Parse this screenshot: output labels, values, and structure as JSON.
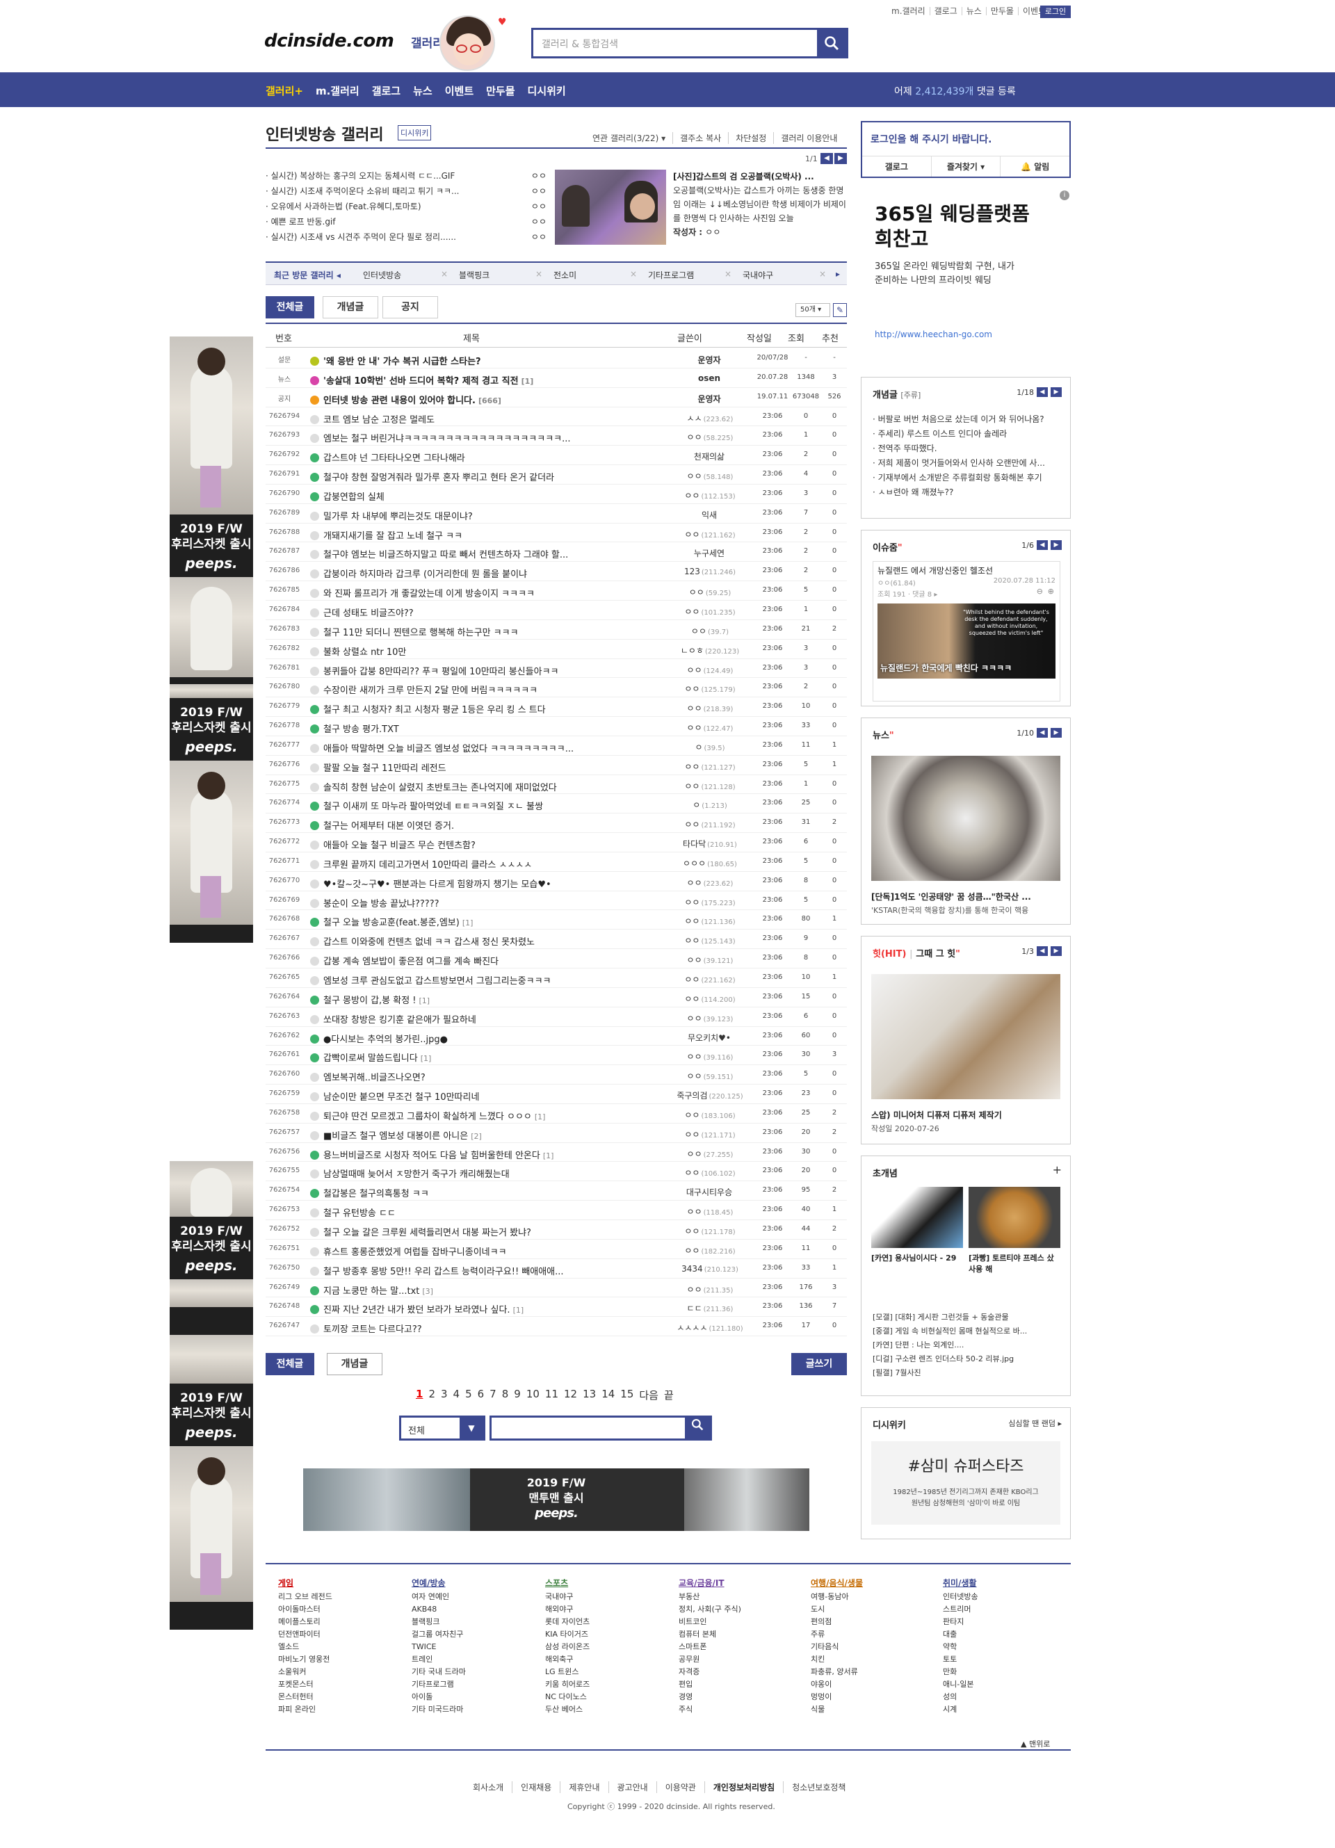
{
  "util_links": [
    "m.갤러리",
    "갤로그",
    "뉴스",
    "만두몰",
    "이벤트"
  ],
  "login_label": "로그인",
  "logo": {
    "main": "dcinside.com",
    "sub": "갤러리"
  },
  "search": {
    "placeholder": "갤러리 & 통합검색"
  },
  "nav": {
    "items": [
      "갤러리+",
      "m.갤러리",
      "갤로그",
      "뉴스",
      "이벤트",
      "만두몰",
      "디시위키"
    ],
    "stat_prefix": "어제",
    "stat_count": "2,412,439개",
    "stat_suffix": "댓글 등록"
  },
  "gallery": {
    "title": "인터넷방송 갤러리",
    "wiki_badge": "디시위키",
    "tools": [
      "연관 갤러리(3/22) ▾",
      "갤주소 복사",
      "차단설정",
      "갤러리 이용안내"
    ]
  },
  "issue": {
    "page": "1/1",
    "list": [
      {
        "t": "· 실시간) 복상하는 홍구의 오지는 동체시력 ㄷㄷ...GIF",
        "w": "ㅇㅇ"
      },
      {
        "t": "· 실시간) 시조새 주먹이운다 소유비 때리고 튀기 ㅋㅋ...",
        "w": "ㅇㅇ"
      },
      {
        "t": "· 오유에서 사과하는법 (Feat.유혜디,토마토)",
        "w": "ㅇㅇ"
      },
      {
        "t": "· 예쁜 로프 반동.gif",
        "w": "ㅇㅇ"
      },
      {
        "t": "· 실시간) 시조새 vs 시견주 주먹이 운다 필로 정리......",
        "w": "ㅇㅇ"
      }
    ],
    "feature_title": "[사진]갑스트의 검 오공블랙(오박사) ...",
    "feature_body": "오공블랙(오박사)는 갑스트가 아끼는 동생중 한명임 이래는 ↓↓베소영님이란 학생 비제이가 비제이를 한명씩 다 인사하는 사진임 오늘",
    "feature_writer_label": "작성자 : ",
    "feature_writer": "ㅇㅇ"
  },
  "recent": {
    "label": "최근 방문 갤러리",
    "items": [
      "인터넷방송",
      "블랙핑크",
      "전소미",
      "기타프로그램",
      "국내야구"
    ]
  },
  "tabs": [
    "전체글",
    "개념글",
    "공지"
  ],
  "per_page": "50개",
  "columns": [
    "번호",
    "제목",
    "글쓴이",
    "작성일",
    "조회",
    "추천"
  ],
  "posts": [
    {
      "no": "설문",
      "icon": "y",
      "title": "'왜 응반 안 내' 가수 복귀 시급한 스타는?",
      "rc": "",
      "writer": "운영자",
      "ip": "",
      "date": "20/07/28",
      "view": "-",
      "rec": "-",
      "notice": true
    },
    {
      "no": "뉴스",
      "icon": "m",
      "title": "'송살대 10학번' 선바 드디어 복학? 제적 경고 직전",
      "rc": "[1]",
      "writer": "osen",
      "ip": "",
      "date": "20.07.28",
      "view": "1348",
      "rec": "3",
      "notice": true
    },
    {
      "no": "공지",
      "icon": "o",
      "title": "인터넷 방송 관련 내용이 있어야 합니다.",
      "rc": "[666]",
      "writer": "운영자",
      "ip": "",
      "date": "19.07.11",
      "view": "673048",
      "rec": "526",
      "notice": true
    },
    {
      "no": "7626794",
      "icon": "",
      "title": "코트 엠보 남순 고정은 멀레도",
      "rc": "",
      "writer": "ㅅㅅ",
      "ip": "(223.62)",
      "date": "23:06",
      "view": "0",
      "rec": "0"
    },
    {
      "no": "7626793",
      "icon": "",
      "title": "엠보는 철구 버린거냐ㅋㅋㅋㅋㅋㅋㅋㅋㅋㅋㅋㅋㅋㅋㅋㅋㅋㅋㅋ...",
      "rc": "",
      "writer": "ㅇㅇ",
      "ip": "(58.225)",
      "date": "23:06",
      "view": "1",
      "rec": "0"
    },
    {
      "no": "7626792",
      "icon": "g",
      "title": "갑스트야 넌 그타타나오면 그타나해라",
      "rc": "",
      "writer": "천재의삶",
      "ip": "",
      "date": "23:06",
      "view": "2",
      "rec": "0"
    },
    {
      "no": "7626791",
      "icon": "g",
      "title": "철구야 창현 잘멍겨줘라 밀가루 혼자 뿌리고 현타 온거 같더라",
      "rc": "",
      "writer": "ㅇㅇ",
      "ip": "(58.148)",
      "date": "23:06",
      "view": "4",
      "rec": "0"
    },
    {
      "no": "7626790",
      "icon": "g",
      "title": "갑붕연합의 실체",
      "rc": "",
      "writer": "ㅇㅇ",
      "ip": "(112.153)",
      "date": "23:06",
      "view": "3",
      "rec": "0"
    },
    {
      "no": "7626789",
      "icon": "",
      "title": "밀가루 차 내부에 뿌리는것도 대문이냐?",
      "rc": "",
      "writer": "익새",
      "ip": "",
      "date": "23:06",
      "view": "7",
      "rec": "0"
    },
    {
      "no": "7626788",
      "icon": "",
      "title": "개돼지새기를 잘 잡고 노네 철구 ㅋㅋ",
      "rc": "",
      "writer": "ㅇㅇ",
      "ip": "(121.162)",
      "date": "23:06",
      "view": "2",
      "rec": "0"
    },
    {
      "no": "7626787",
      "icon": "",
      "title": "철구야 엠보는 비글즈하지말고 따로 빼서 컨텐츠하자 그래야 할...",
      "rc": "",
      "writer": "누구세연",
      "ip": "",
      "date": "23:06",
      "view": "2",
      "rec": "0"
    },
    {
      "no": "7626786",
      "icon": "",
      "title": "갑붕이라 하지마라 갑크루 (이거리한데 뭔 롤을 붙이냐",
      "rc": "",
      "writer": "123",
      "ip": "(211.246)",
      "date": "23:06",
      "view": "2",
      "rec": "0"
    },
    {
      "no": "7626785",
      "icon": "",
      "title": "와 진짜 롤프리가 개 좋갈았는데 이게 방송이지 ㅋㅋㅋㅋ",
      "rc": "",
      "writer": "ㅇㅇ",
      "ip": "(59.25)",
      "date": "23:06",
      "view": "5",
      "rec": "0"
    },
    {
      "no": "7626784",
      "icon": "",
      "title": "근데 성태도 비글즈야??",
      "rc": "",
      "writer": "ㅇㅇ",
      "ip": "(101.235)",
      "date": "23:06",
      "view": "1",
      "rec": "0"
    },
    {
      "no": "7626783",
      "icon": "",
      "title": "철구 11만 되더니 찐텐으로 행복해 하는구만 ㅋㅋㅋ",
      "rc": "",
      "writer": "ㅇㅇ",
      "ip": "(39.7)",
      "date": "23:06",
      "view": "21",
      "rec": "2"
    },
    {
      "no": "7626782",
      "icon": "",
      "title": "불화 상렬쇼 ntr 10만",
      "rc": "",
      "writer": "ㄴㅇㅎ",
      "ip": "(220.123)",
      "date": "23:06",
      "view": "3",
      "rec": "0"
    },
    {
      "no": "7626781",
      "icon": "",
      "title": "봉퀴들아 갑붕 8만따리?? 푸ㅋ 평일에 10만따리 봉신들아ㅋㅋ",
      "rc": "",
      "writer": "ㅇㅇ",
      "ip": "(124.49)",
      "date": "23:06",
      "view": "3",
      "rec": "0"
    },
    {
      "no": "7626780",
      "icon": "",
      "title": "수장이란 새끼가 크루 만든지 2달 만에 버림ㅋㅋㅋㅋㅋㅋ",
      "rc": "",
      "writer": "ㅇㅇ",
      "ip": "(125.179)",
      "date": "23:06",
      "view": "2",
      "rec": "0"
    },
    {
      "no": "7626779",
      "icon": "g",
      "title": "철구 최고 시청자? 최고 시청자 평균 1등은 우리 킹 스 트다",
      "rc": "",
      "writer": "ㅇㅇ",
      "ip": "(218.39)",
      "date": "23:06",
      "view": "10",
      "rec": "0"
    },
    {
      "no": "7626778",
      "icon": "g",
      "title": "철구 방송 평가.TXT",
      "rc": "",
      "writer": "ㅇㅇ",
      "ip": "(122.47)",
      "date": "23:06",
      "view": "33",
      "rec": "0"
    },
    {
      "no": "7626777",
      "icon": "",
      "title": "애들아 딱말하면 오늘 비글즈 엠보성 없었다 ㅋㅋㅋㅋㅋㅋㅋㅋㅋ...",
      "rc": "",
      "writer": "ㅇ",
      "ip": "(39.5)",
      "date": "23:06",
      "view": "11",
      "rec": "1"
    },
    {
      "no": "7626776",
      "icon": "",
      "title": "팔팔 오늘 철구 11만따리 레전드",
      "rc": "",
      "writer": "ㅇㅇ",
      "ip": "(121.127)",
      "date": "23:06",
      "view": "5",
      "rec": "1"
    },
    {
      "no": "7626775",
      "icon": "",
      "title": "솔직히 창현 남순이 살렸지 초반토크는 존나억지에 재미없었다",
      "rc": "",
      "writer": "ㅇㅇ",
      "ip": "(121.128)",
      "date": "23:06",
      "view": "1",
      "rec": "0"
    },
    {
      "no": "7626774",
      "icon": "g",
      "title": "철구 이새끼 또 마누라 팔아먹었네 ㅌㅌㅋㅋ외질 ㅈㄴ 불쌍",
      "rc": "",
      "writer": "ㅇ",
      "ip": "(1.213)",
      "date": "23:06",
      "view": "25",
      "rec": "0"
    },
    {
      "no": "7626773",
      "icon": "g",
      "title": "철구는 어제부터 대본 이엿던 증거.",
      "rc": "",
      "writer": "ㅇㅇ",
      "ip": "(211.192)",
      "date": "23:06",
      "view": "31",
      "rec": "2"
    },
    {
      "no": "7626772",
      "icon": "",
      "title": "애들아 오늘 철구 비글즈 무슨 컨텐츠함?",
      "rc": "",
      "writer": "타다닥",
      "ip": "(210.91)",
      "date": "23:06",
      "view": "6",
      "rec": "0"
    },
    {
      "no": "7626771",
      "icon": "",
      "title": "크루원 끝까지 데리고가면서 10만따리 클라스 ㅅㅅㅅㅅ",
      "rc": "",
      "writer": "ㅇㅇㅇ",
      "ip": "(180.65)",
      "date": "23:06",
      "view": "5",
      "rec": "0"
    },
    {
      "no": "7626770",
      "icon": "",
      "title": "♥•칼~갓~구♥• 팬분과는 다르게 힘왕까지 챙기는 모습♥•",
      "rc": "",
      "writer": "ㅇㅇ",
      "ip": "(223.62)",
      "date": "23:06",
      "view": "8",
      "rec": "0"
    },
    {
      "no": "7626769",
      "icon": "",
      "title": "봉순이 오늘 방송 끝났냐?????",
      "rc": "",
      "writer": "ㅇㅇ",
      "ip": "(175.223)",
      "date": "23:06",
      "view": "5",
      "rec": "0"
    },
    {
      "no": "7626768",
      "icon": "g",
      "title": "철구 오늘 방송교훈(feat.봉준,엠보)",
      "rc": "[1]",
      "writer": "ㅇㅇ",
      "ip": "(121.136)",
      "date": "23:06",
      "view": "80",
      "rec": "1"
    },
    {
      "no": "7626767",
      "icon": "",
      "title": "갑스트 이와중에 컨텐츠 없네 ㅋㅋ 갑스새 정신 못차렸노",
      "rc": "",
      "writer": "ㅇㅇ",
      "ip": "(125.143)",
      "date": "23:06",
      "view": "9",
      "rec": "0"
    },
    {
      "no": "7626766",
      "icon": "",
      "title": "갑봉 계속 엠보밥이 좋은점 여그를 계속 빠진다",
      "rc": "",
      "writer": "ㅇㅇ",
      "ip": "(39.121)",
      "date": "23:06",
      "view": "8",
      "rec": "0"
    },
    {
      "no": "7626765",
      "icon": "",
      "title": "엠보성 크루 관심도없고 갑스트방보면서 그림그리는중ㅋㅋㅋ",
      "rc": "",
      "writer": "ㅇㅇ",
      "ip": "(221.162)",
      "date": "23:06",
      "view": "10",
      "rec": "1"
    },
    {
      "no": "7626764",
      "icon": "g",
      "title": "철구 몽방이 갑,봉 확정 !",
      "rc": "[1]",
      "writer": "ㅇㅇ",
      "ip": "(114.200)",
      "date": "23:06",
      "view": "15",
      "rec": "0"
    },
    {
      "no": "7626763",
      "icon": "",
      "title": "쏘대장 창방은 킹기훈 같은애가 필요하네",
      "rc": "",
      "writer": "ㅇㅇ",
      "ip": "(39.123)",
      "date": "23:06",
      "view": "6",
      "rec": "0"
    },
    {
      "no": "7626762",
      "icon": "g",
      "title": "●다시보는 추억의 봉가린..jpg●",
      "rc": "",
      "writer": "무오키치♥•",
      "ip": "",
      "date": "23:06",
      "view": "60",
      "rec": "0"
    },
    {
      "no": "7626761",
      "icon": "g",
      "title": "갑빡이로써 말씀드립니다",
      "rc": "[1]",
      "writer": "ㅇㅇ",
      "ip": "(39.116)",
      "date": "23:06",
      "view": "30",
      "rec": "3"
    },
    {
      "no": "7626760",
      "icon": "",
      "title": "엠보복귀해..비글즈나오면?",
      "rc": "",
      "writer": "ㅇㅇ",
      "ip": "(59.151)",
      "date": "23:06",
      "view": "5",
      "rec": "0"
    },
    {
      "no": "7626759",
      "icon": "",
      "title": "남순이만 붙으면 무조건 철구 10만따리네",
      "rc": "",
      "writer": "죽구의검",
      "ip": "(220.125)",
      "date": "23:06",
      "view": "23",
      "rec": "0"
    },
    {
      "no": "7626758",
      "icon": "",
      "title": "퇴근야 딴건 모르겠고 그룹차이 확실하게 느꼈다 ㅇㅇㅇ",
      "rc": "[1]",
      "writer": "ㅇㅇ",
      "ip": "(183.106)",
      "date": "23:06",
      "view": "25",
      "rec": "2"
    },
    {
      "no": "7626757",
      "icon": "",
      "title": "■비글즈 철구 엠보성 대봉이른 아니은",
      "rc": "[2]",
      "writer": "ㅇㅇ",
      "ip": "(121.171)",
      "date": "23:06",
      "view": "20",
      "rec": "2"
    },
    {
      "no": "7626756",
      "icon": "g",
      "title": "용느버비글즈로 시청자 적어도 다음 날 힘버울한테 안온다",
      "rc": "[1]",
      "writer": "ㅇㅇ",
      "ip": "(27.255)",
      "date": "23:06",
      "view": "30",
      "rec": "0"
    },
    {
      "no": "7626755",
      "icon": "",
      "title": "남상멀때매 늦어서 ㅈ망한거 죽구가 캐리해줬는대",
      "rc": "",
      "writer": "ㅇㅇ",
      "ip": "(106.102)",
      "date": "23:06",
      "view": "20",
      "rec": "0"
    },
    {
      "no": "7626754",
      "icon": "g",
      "title": "철갑봉은 철구의흑통청 ㅋㅋ",
      "rc": "",
      "writer": "대구시티우승",
      "ip": "",
      "date": "23:06",
      "view": "95",
      "rec": "2"
    },
    {
      "no": "7626753",
      "icon": "",
      "title": "철구 유턴방송 ㄷㄷ",
      "rc": "",
      "writer": "ㅇㅇ",
      "ip": "(118.45)",
      "date": "23:06",
      "view": "40",
      "rec": "1"
    },
    {
      "no": "7626752",
      "icon": "",
      "title": "철구 오늘 갈은 크루원 세력들리면서 대봉 짜는거 봤냐?",
      "rc": "",
      "writer": "ㅇㅇ",
      "ip": "(121.178)",
      "date": "23:06",
      "view": "44",
      "rec": "2"
    },
    {
      "no": "7626751",
      "icon": "",
      "title": "휴스트 홍롱준했었게 여럽들 잡바구니종이네ㅋㅋ",
      "rc": "",
      "writer": "ㅇㅇ",
      "ip": "(182.216)",
      "date": "23:06",
      "view": "11",
      "rec": "0"
    },
    {
      "no": "7626750",
      "icon": "",
      "title": "철구 방종후 몽방 5만!! 우리 갑스트 능력이라구요!! 빼애애애...",
      "rc": "",
      "writer": "3434",
      "ip": "(210.123)",
      "date": "23:06",
      "view": "33",
      "rec": "1"
    },
    {
      "no": "7626749",
      "icon": "g",
      "title": "지금 노쿵만 하는 말...txt",
      "rc": "[3]",
      "writer": "ㅇㅇ",
      "ip": "(211.35)",
      "date": "23:06",
      "view": "176",
      "rec": "3"
    },
    {
      "no": "7626748",
      "icon": "g",
      "title": "진짜 지난 2년간 내가 봤던 보라가 보라였나 싶다.",
      "rc": "[1]",
      "writer": "ㄷㄷ",
      "ip": "(211.36)",
      "date": "23:06",
      "view": "136",
      "rec": "7"
    },
    {
      "no": "7626747",
      "icon": "",
      "title": "토끼장 코트는 다르다고??",
      "rc": "",
      "writer": "ㅅㅅㅅㅅ",
      "ip": "(121.180)",
      "date": "23:06",
      "view": "17",
      "rec": "0"
    }
  ],
  "bottom": {
    "all": "전체글",
    "concept": "개념글",
    "write": "글쓰기"
  },
  "pages": [
    "1",
    "2",
    "3",
    "4",
    "5",
    "6",
    "7",
    "8",
    "9",
    "10",
    "11",
    "12",
    "13",
    "14",
    "15",
    "다음",
    "끝"
  ],
  "bottom_search": {
    "select": "전체"
  },
  "left_ads": [
    {
      "line1": "2019 F/W",
      "line2": "후리스자켓 출시",
      "brand": "peeps."
    },
    {
      "line1": "2019 F/W",
      "line2": "후리스자켓 출시",
      "brand": "peeps."
    },
    {
      "line1": "2019 F/W",
      "line2": "후리스자켓 출시",
      "brand": "peeps."
    },
    {
      "line1": "2019 F/W",
      "line2": "후리스자켓 출시",
      "brand": "peeps."
    }
  ],
  "bottom_banner": {
    "line1": "2019 F/W",
    "line2": "맨투맨 출시",
    "brand": "peeps."
  },
  "right": {
    "login_msg": "로그인을 해 주시기 바랍니다.",
    "login_links": [
      "갤로그",
      "즐겨찾기 ▾",
      "🔔 알림"
    ],
    "ad": {
      "big1": "365일 웨딩플랫폼",
      "big2": "희찬고",
      "d1": "365일 온라인 웨딩박람회 구현, 내가",
      "d2": "준비하는 나만의 프라이빗 웨딩",
      "url": "http://www.heechan-go.com"
    },
    "concept": {
      "title": "개념글",
      "sub": "[주류]",
      "page": "1/18",
      "items": [
        "· 버팔로 버번 처음으로 샀는데 이거 와 뒤어나옴?",
        "· 주세리) 루스트 이스트 인디아 솔레라",
        "· 전역주 뚜따했다.",
        "· 저희 제품이 멋거들어와서 인사하 오랜만에 사...",
        "· 기재부에서 소개받은 주류컬회랑 통화해본 후기",
        "· ㅅㅂ련아 왜 깨졌누??"
      ]
    },
    "issue": {
      "title": "이슈줌",
      "page": "1/6",
      "headline": "뉴질랜드 에서 개망신중인 헬조선",
      "w": "ㅇㅇ(61.84)",
      "date": "2020.07.28 11:12",
      "meta": "조회 191 · 댓글 8 ▸",
      "caption": "뉴질랜드가 한국에게 빡친다 ㅋㅋㅋㅋ",
      "quote": "\"Whilst behind the defendant's desk the defendant suddenly, and without invitation, squeezed the victim's left\""
    },
    "news": {
      "title": "뉴스",
      "page": "1/10",
      "headline": "[단독]1억도 '인공태양' 꿈 성큼…\"한국산 ...",
      "sub": "'KSTAR(한국의 핵융합 장치)를 통해 한국이 핵융"
    },
    "hit": {
      "title": "힛(HIT)",
      "sub": "그때 그 힛",
      "page": "1/3",
      "headline": "스압) 미니어처 디퓨저 디퓨저 제작기",
      "date": "작성일 2020-07-26"
    },
    "chogaenyeom": {
      "title": "초개념",
      "c1": "[카연] 용사님이시다 - 29",
      "c2": "[과빵] 토르티야 프레스 샀 사용 해",
      "items": [
        "[모갤] [대화] 게시판 그런것들 + 동술관물",
        "[중갤] 게임 속 비현실적인 몸매 현실적으로 바...",
        "[카연] 단편 : 나는 외계인....",
        "[디걸] 구소련 렌즈 인더스타 50-2 리뷰.jpg",
        "[필갤] 7월사진"
      ]
    },
    "wiki": {
      "title": "디시위키",
      "more": "심심할 땐 랜덤 ▸",
      "keyword": "#삼미 슈퍼스타즈",
      "desc1": "1982년~1985년 전기리그까지 존재한 KBO리그",
      "desc2": "원년팀 삼청해현의 '삼미'이 바로 이팀"
    }
  },
  "footer": {
    "cols": [
      {
        "h": "게임",
        "items": [
          "리그 오브 레전드",
          "아이돌마스터",
          "메이플스토리",
          "던전앤파이터",
          "엘소드",
          "마비노기 영웅전",
          "소울워커",
          "포켓몬스터",
          "몬스터헌터",
          "파피 온라인"
        ]
      },
      {
        "h": "연예/방송",
        "items": [
          "여자 연예인",
          "AKB48",
          "블랙핑크",
          "걸그룹 여자친구",
          "TWICE",
          "트레인",
          "기타 국내 드라마",
          "기타프로그램",
          "아이돌",
          "기타 미국드라마"
        ]
      },
      {
        "h": "스포츠",
        "items": [
          "국내야구",
          "해외야구",
          "롯데 자이언츠",
          "KIA 타이거즈",
          "삼성 라이온즈",
          "해외축구",
          "LG 트윈스",
          "키움 히어로즈",
          "NC 다이노스",
          "두산 베어스"
        ]
      },
      {
        "h": "교육/금융/IT",
        "items": [
          "부동산",
          "정치, 사회(구 주식)",
          "비트코인",
          "컴퓨터 본체",
          "스마트폰",
          "공무원",
          "자격증",
          "편입",
          "경영",
          "주식"
        ]
      },
      {
        "h": "여행/음식/생물",
        "items": [
          "여행-동남아",
          "도시",
          "편의점",
          "주류",
          "기타음식",
          "치킨",
          "파충류, 양서류",
          "야옹이",
          "멍멍이",
          "식물"
        ]
      },
      {
        "h": "취미/생활",
        "items": [
          "인터넷방송",
          "스트리머",
          "판타지",
          "대출",
          "약학",
          "토토",
          "만화",
          "애니-일본",
          "성의",
          "시계"
        ]
      }
    ],
    "top_link": "▲ 맨위로",
    "links": [
      "회사소개",
      "인재채용",
      "제휴안내",
      "광고안내",
      "이용약관",
      "개인정보처리방침",
      "청소년보호정책"
    ],
    "copyright": "Copyright ⓒ 1999 - 2020 dcinside. All rights reserved."
  },
  "colors": {
    "brand": "#3b4890",
    "accent_yellow": "#ffd400",
    "notice_red": "#e33333"
  }
}
